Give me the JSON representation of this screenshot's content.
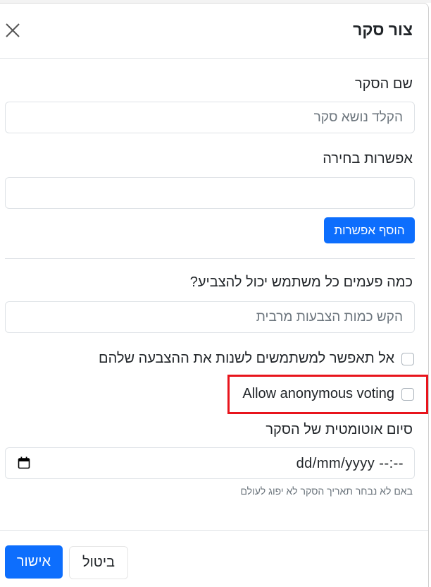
{
  "modal": {
    "title": "צור סקר"
  },
  "poll_name": {
    "label": "שם הסקר",
    "placeholder": "הקלד נושא סקר",
    "value": ""
  },
  "option": {
    "label": "אפשרות בחירה",
    "value": "",
    "add_button_label": "הוסף אפשרות"
  },
  "votes_per_user": {
    "label": "כמה פעמים כל משתמש יכול להצביע?",
    "placeholder": "הקש כמות הצבעות מרבית",
    "value": ""
  },
  "checkboxes": [
    {
      "label": "אל תאפשר למשתמשים לשנות את ההצבעה שלהם",
      "checked": false
    },
    {
      "label": "Allow anonymous voting",
      "checked": false
    }
  ],
  "auto_end": {
    "label": "סיום אוטומטית של הסקר",
    "date_display": "dd/mm/yyyy --:--",
    "hint": "באם לא נבחר תאריך הסקר לא יפוג לעולם"
  },
  "footer": {
    "confirm_label": "אישור",
    "cancel_label": "ביטול"
  },
  "colors": {
    "primary": "#0d6efd",
    "highlight": "#e8141c"
  },
  "icons": {
    "close": "close-icon",
    "calendar": "calendar-icon"
  }
}
